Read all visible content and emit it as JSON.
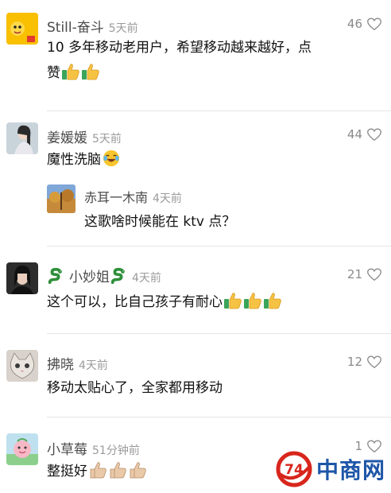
{
  "comments": [
    {
      "name": "Still-奋斗",
      "time": "5天前",
      "likes": "46",
      "text_line1": "10 多年移动老用户，希望移动越来越好，点",
      "text_line2": "赞"
    },
    {
      "name": "姜媛媛",
      "time": "5天前",
      "likes": "44",
      "text": "魔性洗脑",
      "reply": {
        "name": "赤耳一木南",
        "time": "4天前",
        "text": "这歌啥时候能在 ktv 点？"
      }
    },
    {
      "name": "小妙姐",
      "time": "4天前",
      "likes": "21",
      "text": "这个可以，比自己孩子有耐心"
    },
    {
      "name": "拂晓",
      "time": "4天前",
      "likes": "12",
      "text": "移动太贴心了，全家都用移动"
    },
    {
      "name": "小草莓",
      "time": "51分钟前",
      "likes": "1",
      "text": "整挺好"
    }
  ],
  "watermark": {
    "logo_number": "74",
    "text": "中商网"
  },
  "icons": {
    "like": "heart-outline-icon",
    "thumbs": "thumbs-up-emoji",
    "laugh": "laughing-crying-emoji",
    "snake": "snake-emoji"
  }
}
